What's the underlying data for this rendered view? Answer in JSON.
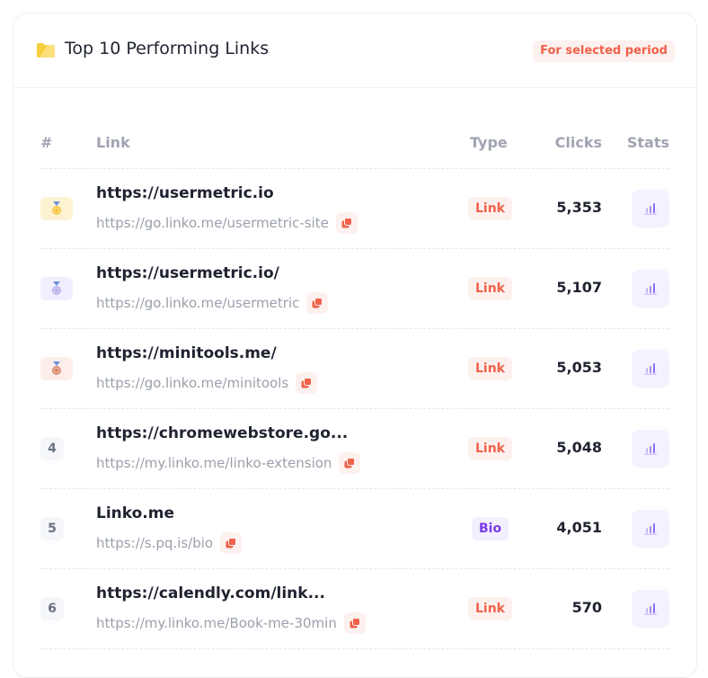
{
  "card": {
    "title": "Top 10 Performing Links",
    "title_icon": "folder-icon",
    "period_badge": "For selected period"
  },
  "table": {
    "columns": [
      "#",
      "Link",
      "Type",
      "Clicks",
      "Stats"
    ],
    "rows": [
      {
        "rank": "1",
        "rank_style": "gold",
        "title": "https://usermetric.io",
        "url": "https://go.linko.me/usermetric-site",
        "type": "Link",
        "clicks": "5,353"
      },
      {
        "rank": "2",
        "rank_style": "silver",
        "title": "https://usermetric.io/",
        "url": "https://go.linko.me/usermetric",
        "type": "Link",
        "clicks": "5,107"
      },
      {
        "rank": "3",
        "rank_style": "bronze",
        "title": "https://minitools.me/",
        "url": "https://go.linko.me/minitools",
        "type": "Link",
        "clicks": "5,053"
      },
      {
        "rank": "4",
        "rank_style": "plain",
        "title": "https://chromewebstore.go...",
        "url": "https://my.linko.me/linko-extension",
        "type": "Link",
        "clicks": "5,048"
      },
      {
        "rank": "5",
        "rank_style": "plain",
        "title": "Linko.me",
        "url": "https://s.pq.is/bio",
        "type": "Bio",
        "clicks": "4,051"
      },
      {
        "rank": "6",
        "rank_style": "plain",
        "title": "https://calendly.com/link...",
        "url": "https://my.linko.me/Book-me-30min",
        "type": "Link",
        "clicks": "570"
      }
    ]
  },
  "colors": {
    "accent_red": "#f0614a",
    "accent_purple": "#7c3aed",
    "gold": "#f5c542",
    "silver": "#b9b3e8",
    "bronze": "#d98a6b"
  },
  "icons": {
    "medal": "medal-icon",
    "copy": "copy-icon",
    "stats": "bar-chart-icon"
  }
}
